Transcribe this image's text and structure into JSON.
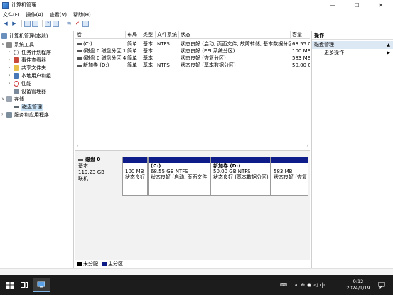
{
  "window": {
    "title": "计算机管理",
    "minimize": "—",
    "maximize": "☐",
    "close": "✕"
  },
  "menu": [
    "文件(F)",
    "操作(A)",
    "查看(V)",
    "帮助(H)"
  ],
  "tree": {
    "root": "计算机管理(本地)",
    "system_tools": "系统工具",
    "task_scheduler": "任务计划程序",
    "event_viewer": "事件查看器",
    "shared_folders": "共享文件夹",
    "local_users": "本地用户和组",
    "performance": "性能",
    "device_manager": "设备管理器",
    "storage": "存储",
    "disk_management": "磁盘管理",
    "services_apps": "服务和应用程序"
  },
  "columns": [
    "卷",
    "布局",
    "类型",
    "文件系统",
    "状态",
    "容量"
  ],
  "volumes": [
    {
      "name": "(C:)",
      "layout": "简单",
      "type": "基本",
      "fs": "NTFS",
      "status": "状态良好 (启动, 页面文件, 故障转储, 基本数据分区)",
      "capacity": "68.55 G"
    },
    {
      "name": "(磁盘 0 磁盘分区 1)",
      "layout": "简单",
      "type": "基本",
      "fs": "",
      "status": "状态良好 (EFI 系统分区)",
      "capacity": "100 MB"
    },
    {
      "name": "(磁盘 0 磁盘分区 4)",
      "layout": "简单",
      "type": "基本",
      "fs": "",
      "status": "状态良好 (恢复分区)",
      "capacity": "583 MB"
    },
    {
      "name": "新加卷 (D:)",
      "layout": "简单",
      "type": "基本",
      "fs": "NTFS",
      "status": "状态良好 (基本数据分区)",
      "capacity": "50.00 G"
    }
  ],
  "actions": {
    "header": "操作",
    "section": "磁盘管理",
    "more": "更多操作"
  },
  "disk": {
    "name": "磁盘 0",
    "type": "基本",
    "size": "119.23 GB",
    "state": "联机",
    "partitions": [
      {
        "title": "",
        "size": "100 MB",
        "status": "状态良好"
      },
      {
        "title": "(C:)",
        "size": "68.55 GB NTFS",
        "status": "状态良好 (启动, 页面文件, 故"
      },
      {
        "title": "新加卷 (D:)",
        "size": "50.00 GB NTFS",
        "status": "状态良好 (基本数据分区)"
      },
      {
        "title": "",
        "size": "583 MB",
        "status": "状态良好 (恢复"
      }
    ]
  },
  "legend": [
    {
      "label": "未分配",
      "color": "#000000"
    },
    {
      "label": "主分区",
      "color": "#0e1c8a"
    }
  ],
  "taskbar": {
    "time": "9:12",
    "date": "2024/1/19",
    "ime": "中"
  },
  "colors": {
    "primary_partition": "#0e1c8a",
    "selection": "#cce4f7",
    "taskbar": "#1c1c1c"
  }
}
